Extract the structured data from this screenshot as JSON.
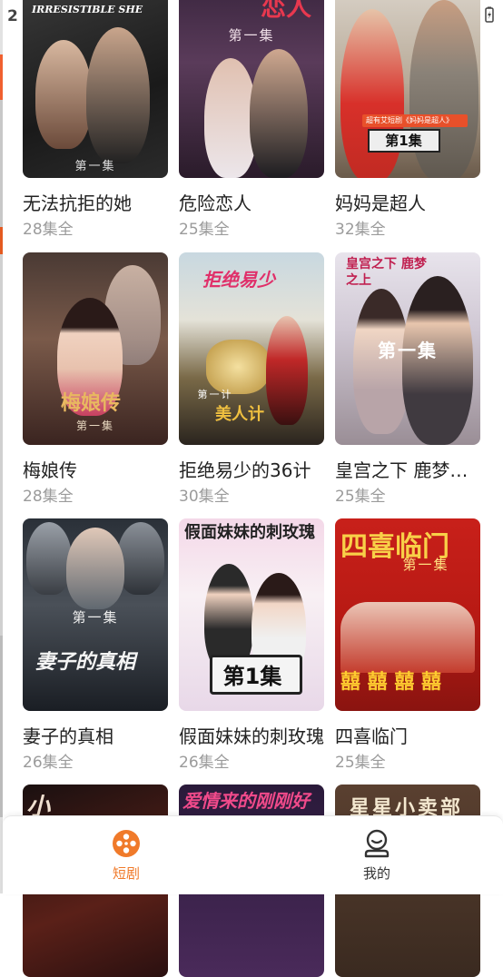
{
  "status_bar": {
    "time": "2"
  },
  "dramas": [
    {
      "title": "无法抗拒的她",
      "episodes": "28集全",
      "poster_text": "第一集",
      "poster_art": "IRRESISTIBLE SHE"
    },
    {
      "title": "危险恋人",
      "episodes": "25集全",
      "poster_text": "第一集",
      "poster_art": "恋人"
    },
    {
      "title": "妈妈是超人",
      "episodes": "32集全",
      "poster_text": "第1集",
      "poster_art": "超有艾短剧《妈妈是超人》"
    },
    {
      "title": "梅娘传",
      "episodes": "28集全",
      "poster_text": "第一集",
      "poster_art": "梅娘传"
    },
    {
      "title": "拒绝易少的36计",
      "episodes": "30集全",
      "poster_text": "第一计",
      "poster_art": "美人计"
    },
    {
      "title": "皇宫之下 鹿梦之上",
      "episodes": "25集全",
      "poster_text": "第一集",
      "poster_art": "皇宫之下 鹿梦之上"
    },
    {
      "title": "妻子的真相",
      "episodes": "26集全",
      "poster_text": "第一集",
      "poster_art": "妻子的真相"
    },
    {
      "title": "假面妹妹的刺玫瑰",
      "episodes": "26集全",
      "poster_text": "第1集",
      "poster_art": "假面妹妹的刺玫瑰"
    },
    {
      "title": "四喜临门",
      "episodes": "25集全",
      "poster_text": "第一集",
      "poster_art": "四喜临门"
    },
    {
      "title": "",
      "episodes": "",
      "poster_text": "",
      "poster_art": ""
    },
    {
      "title": "",
      "episodes": "",
      "poster_text": "",
      "poster_art": "爱情来的刚刚好"
    },
    {
      "title": "",
      "episodes": "",
      "poster_text": "",
      "poster_art": "星星小卖部"
    }
  ],
  "tabbar": {
    "tabs": [
      {
        "label": "短剧",
        "icon": "film-reel-icon",
        "active": true,
        "color": "#f07a2a"
      },
      {
        "label": "我的",
        "icon": "user-profile-icon",
        "active": false,
        "color": "#333333"
      }
    ]
  },
  "colors": {
    "accent": "#f07a2a",
    "count_gray": "#9b9b9b"
  }
}
